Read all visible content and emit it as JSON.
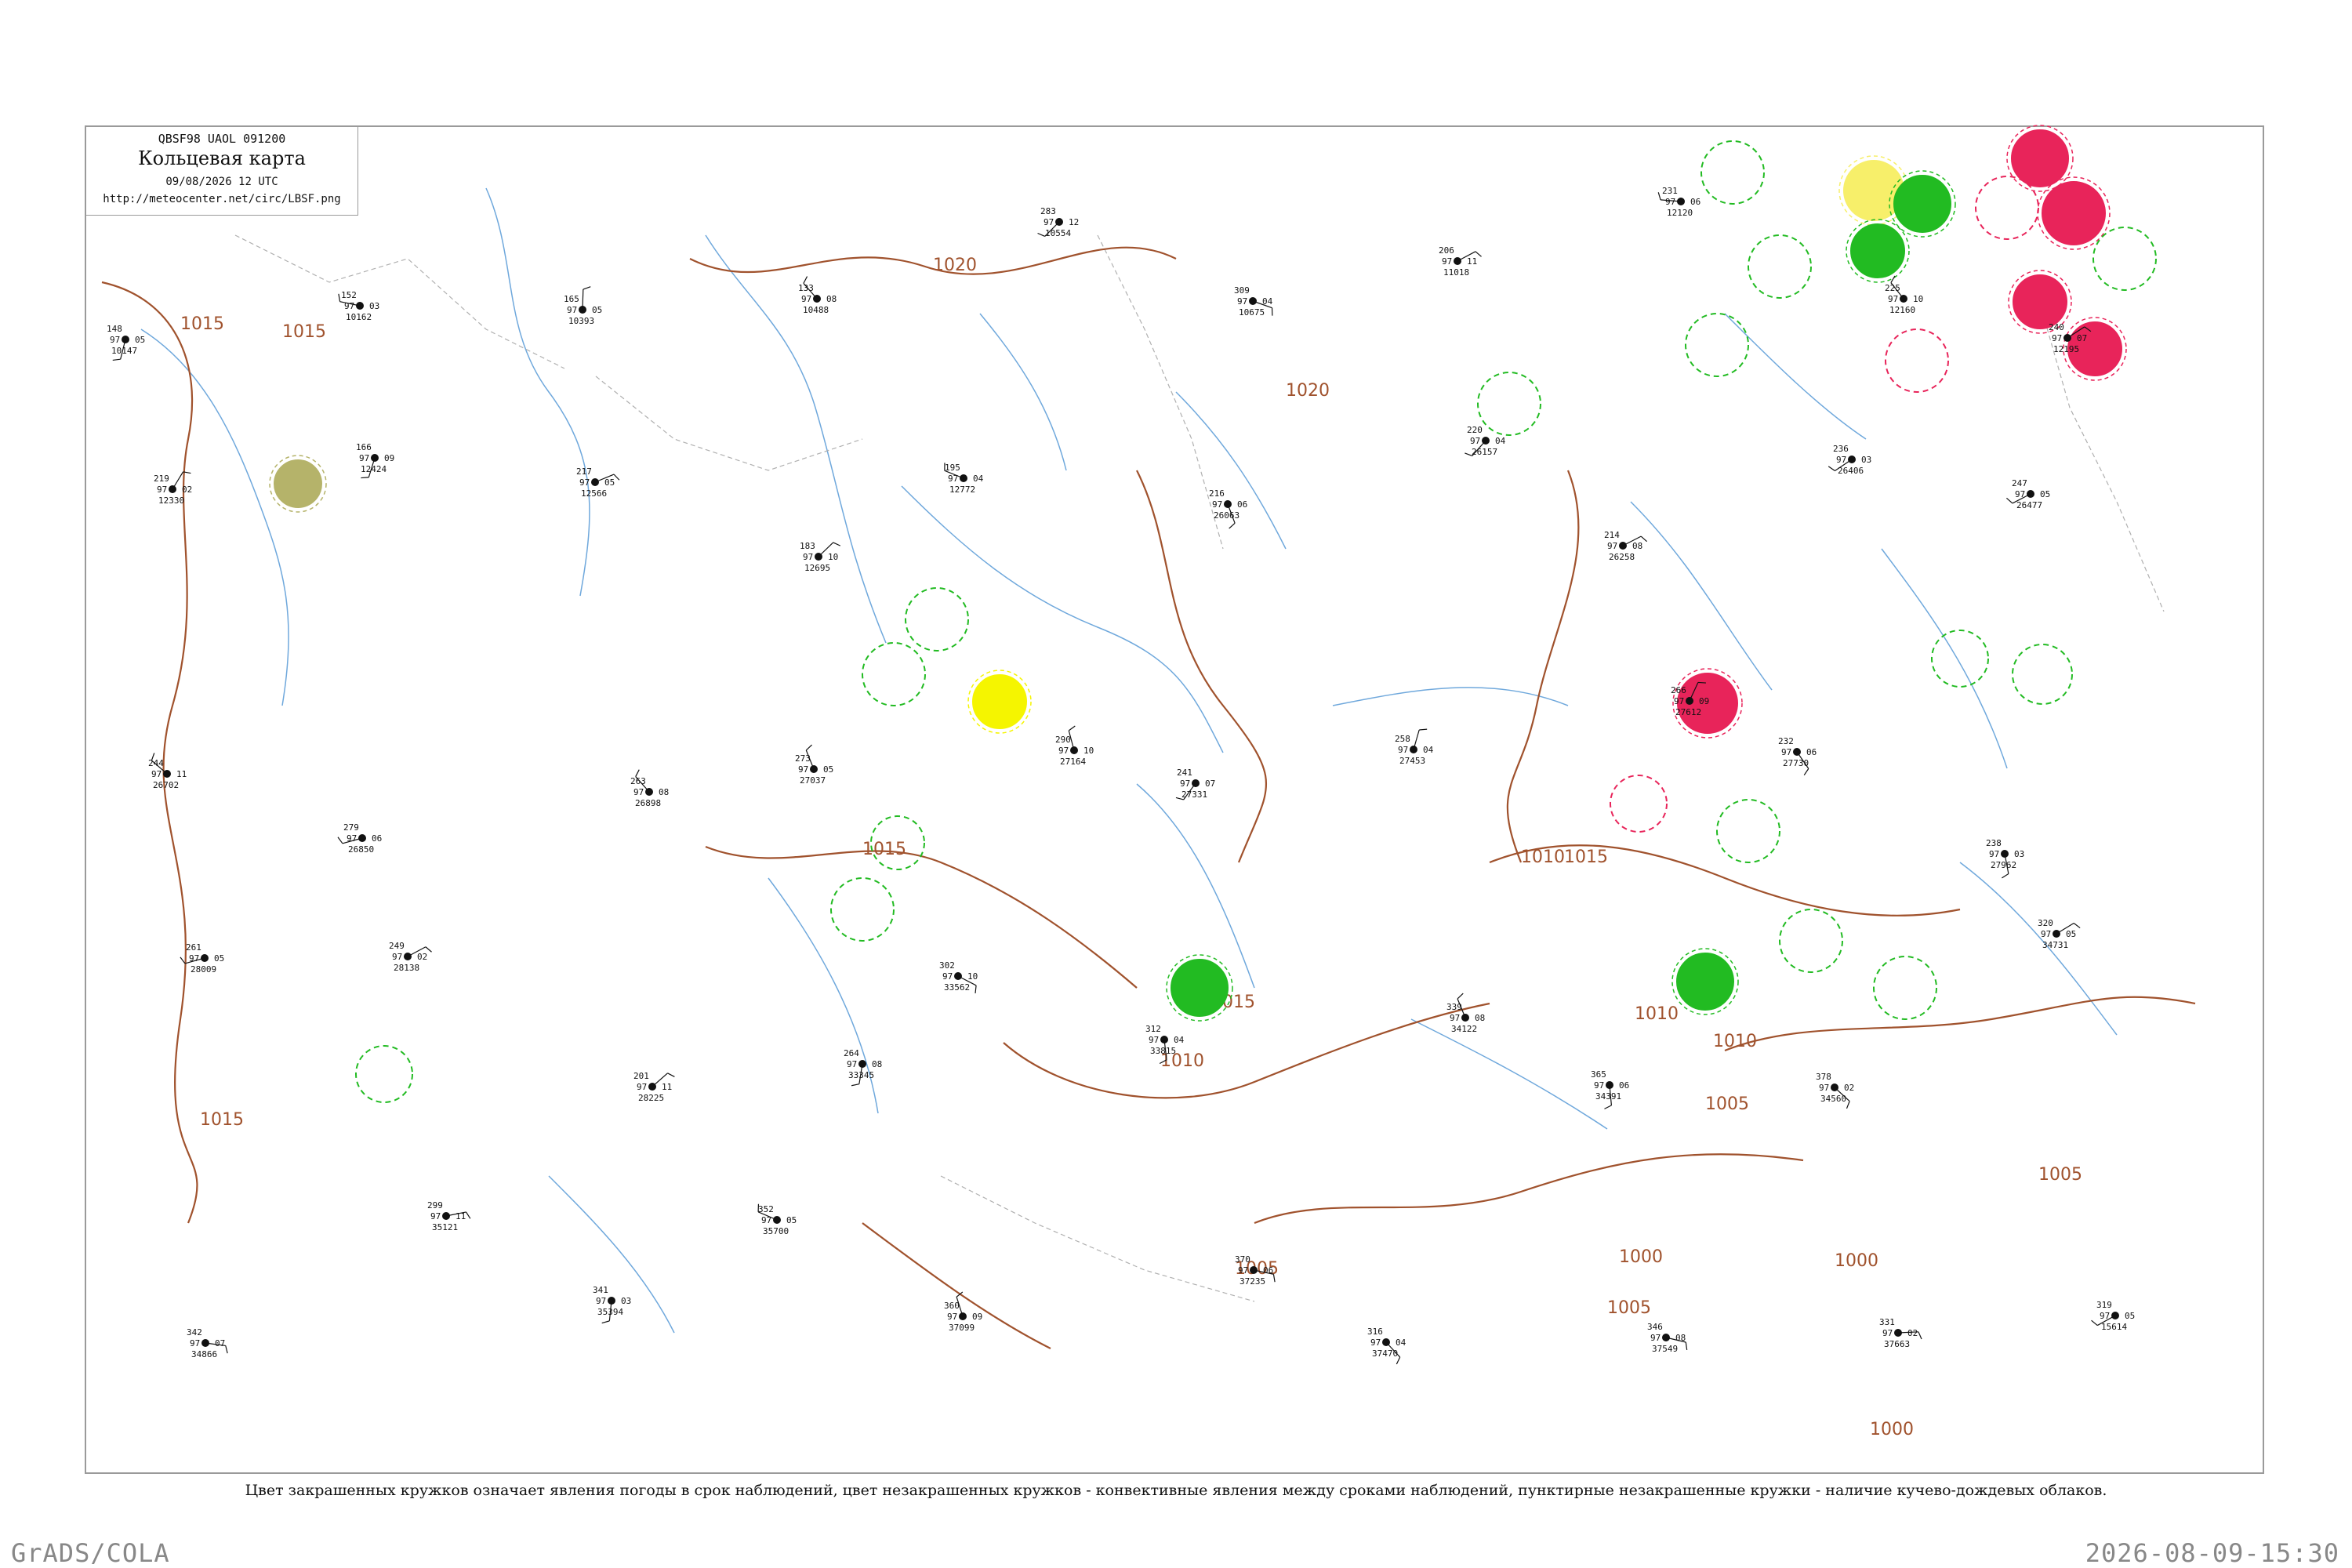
{
  "header": {
    "codes": "QBSF98  UAOL  091200",
    "title": "Кольцевая карта",
    "datetime": "09/08/2026 12 UTC",
    "url": "http://meteocenter.net/circ/LBSF.png"
  },
  "caption": "Цвет закрашенных кружков означает явления погоды в срок наблюдений, цвет незакрашенных кружков - конвективные явления между сроками наблюдений, пунктирные незакрашенные кружки - наличие кучево-дождевых облаков.",
  "footer": {
    "left": "GrADS/COLA",
    "right": "2026-08-09-15:30"
  },
  "colors": {
    "isobar": "#a0522d",
    "river": "#6fa8dc",
    "border": "#b0b0b0",
    "green": "#22bb22",
    "red": "#e8245a",
    "yellow": "#f5f500",
    "olive": "#b5b36a",
    "light_yellow": "#f7ef6a"
  },
  "isobar_labels": [
    "1015",
    "1015",
    "1015",
    "1020",
    "1020",
    "1015",
    "1015",
    "1015",
    "1010",
    "1010",
    "1005",
    "1005",
    "1010",
    "1005",
    "1005",
    "1000",
    "1000",
    "1000",
    "1010"
  ],
  "stations": [
    {
      "t": "148",
      "p": "97",
      "d": "05",
      "name": "10147"
    },
    {
      "t": "152",
      "p": "97",
      "d": "03",
      "name": "10162"
    },
    {
      "t": "165",
      "p": "97",
      "d": "05",
      "name": "10393"
    },
    {
      "t": "133",
      "p": "97",
      "d": "08",
      "name": "10488"
    },
    {
      "t": "283",
      "p": "97",
      "d": "12",
      "name": "10554"
    },
    {
      "t": "309",
      "p": "97",
      "d": "04",
      "name": "10675"
    },
    {
      "t": "206",
      "p": "97",
      "d": "11",
      "name": "11018"
    },
    {
      "t": "231",
      "p": "97",
      "d": "06",
      "name": "12120"
    },
    {
      "t": "225",
      "p": "97",
      "d": "10",
      "name": "12160"
    },
    {
      "t": "240",
      "p": "97",
      "d": "07",
      "name": "12195"
    },
    {
      "t": "219",
      "p": "97",
      "d": "02",
      "name": "12330"
    },
    {
      "t": "166",
      "p": "97",
      "d": "09",
      "name": "12424"
    },
    {
      "t": "217",
      "p": "97",
      "d": "05",
      "name": "12566"
    },
    {
      "t": "183",
      "p": "97",
      "d": "10",
      "name": "12695"
    },
    {
      "t": "195",
      "p": "97",
      "d": "04",
      "name": "12772"
    },
    {
      "t": "216",
      "p": "97",
      "d": "06",
      "name": "26063"
    },
    {
      "t": "220",
      "p": "97",
      "d": "04",
      "name": "26157"
    },
    {
      "t": "214",
      "p": "97",
      "d": "08",
      "name": "26258"
    },
    {
      "t": "236",
      "p": "97",
      "d": "03",
      "name": "26406"
    },
    {
      "t": "247",
      "p": "97",
      "d": "05",
      "name": "26477"
    },
    {
      "t": "244",
      "p": "97",
      "d": "11",
      "name": "26702"
    },
    {
      "t": "279",
      "p": "97",
      "d": "06",
      "name": "26850"
    },
    {
      "t": "263",
      "p": "97",
      "d": "08",
      "name": "26898"
    },
    {
      "t": "273",
      "p": "97",
      "d": "05",
      "name": "27037"
    },
    {
      "t": "290",
      "p": "97",
      "d": "10",
      "name": "27164"
    },
    {
      "t": "241",
      "p": "97",
      "d": "07",
      "name": "27331"
    },
    {
      "t": "258",
      "p": "97",
      "d": "04",
      "name": "27453"
    },
    {
      "t": "266",
      "p": "97",
      "d": "09",
      "name": "27612"
    },
    {
      "t": "232",
      "p": "97",
      "d": "06",
      "name": "27730"
    },
    {
      "t": "238",
      "p": "97",
      "d": "03",
      "name": "27962"
    },
    {
      "t": "261",
      "p": "97",
      "d": "05",
      "name": "28009"
    },
    {
      "t": "249",
      "p": "97",
      "d": "02",
      "name": "28138"
    },
    {
      "t": "201",
      "p": "97",
      "d": "11",
      "name": "28225"
    },
    {
      "t": "264",
      "p": "97",
      "d": "08",
      "name": "33345"
    },
    {
      "t": "302",
      "p": "97",
      "d": "10",
      "name": "33562"
    },
    {
      "t": "312",
      "p": "97",
      "d": "04",
      "name": "33815"
    },
    {
      "t": "339",
      "p": "97",
      "d": "08",
      "name": "34122"
    },
    {
      "t": "365",
      "p": "97",
      "d": "06",
      "name": "34391"
    },
    {
      "t": "378",
      "p": "97",
      "d": "02",
      "name": "34560"
    },
    {
      "t": "320",
      "p": "97",
      "d": "05",
      "name": "34731"
    },
    {
      "t": "342",
      "p": "97",
      "d": "07",
      "name": "34866"
    },
    {
      "t": "299",
      "p": "97",
      "d": "11",
      "name": "35121"
    },
    {
      "t": "341",
      "p": "97",
      "d": "03",
      "name": "35394"
    },
    {
      "t": "352",
      "p": "97",
      "d": "05",
      "name": "35700"
    },
    {
      "t": "360",
      "p": "97",
      "d": "09",
      "name": "37099"
    },
    {
      "t": "370",
      "p": "97",
      "d": "06",
      "name": "37235"
    },
    {
      "t": "316",
      "p": "97",
      "d": "04",
      "name": "37470"
    },
    {
      "t": "346",
      "p": "97",
      "d": "08",
      "name": "37549"
    },
    {
      "t": "331",
      "p": "97",
      "d": "02",
      "name": "37663"
    },
    {
      "t": "319",
      "p": "97",
      "d": "05",
      "name": "15614"
    }
  ]
}
